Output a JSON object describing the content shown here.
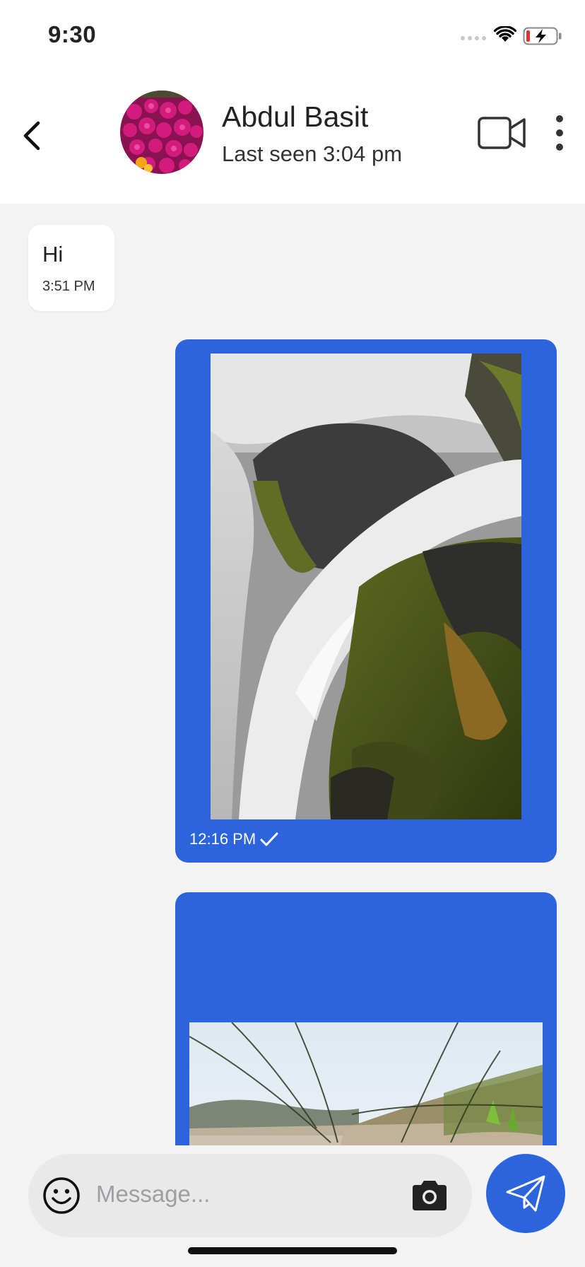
{
  "status_bar": {
    "time": "9:30"
  },
  "header": {
    "contact_name": "Abdul Basit",
    "last_seen": "Last seen 3:04 pm",
    "icons": [
      "back-arrow-icon",
      "avatar-flowers",
      "video-call-icon",
      "more-vertical-icon"
    ]
  },
  "messages": [
    {
      "direction": "incoming",
      "text": "Hi",
      "time": "3:51 PM"
    },
    {
      "direction": "outgoing",
      "type": "image",
      "image": "waterfall over mossy rocks",
      "time": "12:16 PM",
      "status": "sent-check"
    },
    {
      "direction": "outgoing",
      "type": "image",
      "image": "beach grass and dunes",
      "time": ""
    }
  ],
  "composer": {
    "placeholder": "Message..."
  },
  "colors": {
    "accent": "#2b64dc",
    "background": "#f3f3f4",
    "incoming_bubble": "#ffffff"
  }
}
